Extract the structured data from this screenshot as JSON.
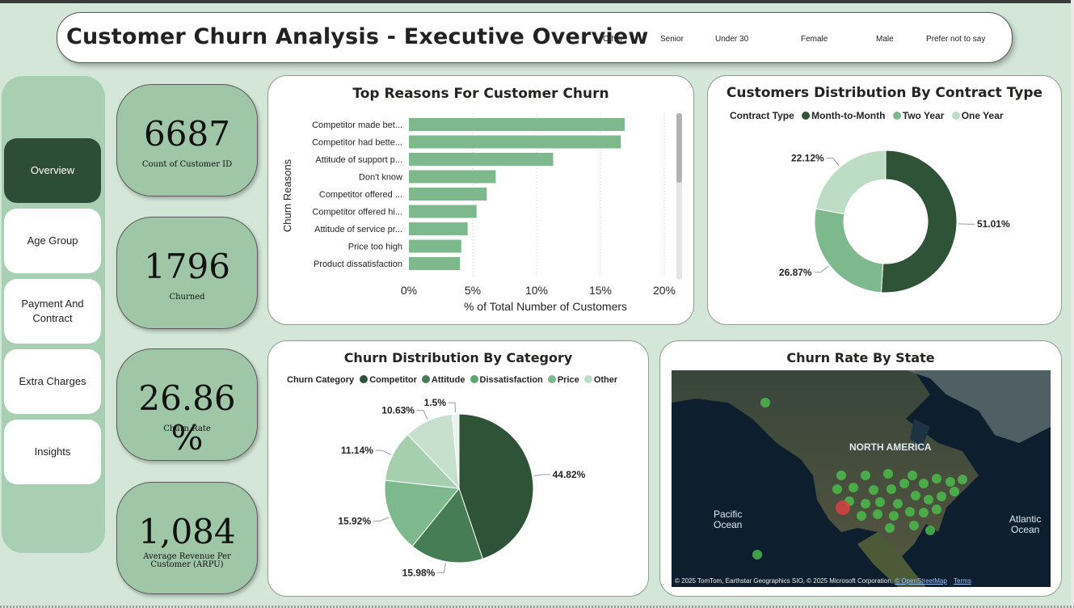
{
  "header": {
    "title": "Customer Churn Analysis - Executive Overview",
    "filters": [
      "Other",
      "Senior",
      "Under 30",
      "Female",
      "Male",
      "Prefer not to say"
    ]
  },
  "nav": {
    "items": [
      {
        "label": "Overview",
        "active": true
      },
      {
        "label": "Age Group",
        "active": false
      },
      {
        "label": "Payment And Contract",
        "active": false
      },
      {
        "label": "Extra Charges",
        "active": false
      },
      {
        "label": "Insights",
        "active": false
      }
    ]
  },
  "kpis": [
    {
      "value": "6687",
      "label": "Count of Customer ID"
    },
    {
      "value": "1796",
      "label": "Churned"
    },
    {
      "value": "26.86 %",
      "label": "Churn Rate"
    },
    {
      "value": "1,084",
      "label": "Average Revenue Per Customer (ARPU)"
    }
  ],
  "colors": {
    "dark_green": "#2f5337",
    "mid_green": "#467d54",
    "green": "#5fa56d",
    "light_green": "#7db98c",
    "pale_green": "#bcdcc4",
    "bar": "#7db98c",
    "accent_bg": "#d3e6d8"
  },
  "reasons_chart": {
    "title": "Top Reasons For Customer Churn",
    "ylabel": "Churn Reasons",
    "xlabel": "% of Total Number of Customers"
  },
  "contract_chart": {
    "title": "Customers Distribution By Contract Type",
    "legend_title": "Contract Type"
  },
  "category_chart": {
    "title": "Churn Distribution By Category",
    "legend_title": "Churn Category"
  },
  "map": {
    "title": "Churn Rate By State",
    "labels": {
      "continent": "NORTH AMERICA",
      "pacific": "Pacific\nOcean",
      "atlantic": "Atlantic\nOcean"
    },
    "attribution": "© 2025 TomTom, Earthstar Geographics SIO, © 2025 Microsoft Corporation, ",
    "osm_link": "© OpenStreetMap",
    "terms_link": "Terms"
  },
  "chart_data": [
    {
      "type": "bar",
      "orientation": "horizontal",
      "title": "Top Reasons For Customer Churn",
      "ylabel": "Churn Reasons",
      "xlabel": "% of Total Number of Customers",
      "categories": [
        "Competitor made bet...",
        "Competitor had bette...",
        "Attitude of support p...",
        "Don't know",
        "Competitor offered ...",
        "Competitor offered hi...",
        "Attitude of service pr...",
        "Price too high",
        "Product dissatisfaction"
      ],
      "values": [
        16.9,
        16.6,
        11.3,
        6.8,
        6.1,
        5.3,
        4.6,
        4.1,
        4.0
      ],
      "xticks": [
        "0%",
        "5%",
        "10%",
        "15%",
        "20%"
      ],
      "xlim": [
        0,
        20
      ],
      "grid": true
    },
    {
      "type": "pie",
      "variant": "donut",
      "title": "Customers Distribution By Contract Type",
      "legend_title": "Contract Type",
      "labels": [
        "Month-to-Month",
        "Two Year",
        "One Year"
      ],
      "values": [
        51.01,
        26.87,
        22.12
      ],
      "value_labels": [
        "51.01%",
        "26.87%",
        "22.12%"
      ],
      "colors": [
        "#2f5337",
        "#7db98c",
        "#bcdcc4"
      ],
      "legend_position": "top"
    },
    {
      "type": "pie",
      "title": "Churn Distribution By Category",
      "legend_title": "Churn Category",
      "labels": [
        "Competitor",
        "Attitude",
        "Dissatisfaction",
        "Price",
        "Other"
      ],
      "values": [
        44.82,
        15.98,
        15.92,
        11.14,
        10.63,
        1.5
      ],
      "value_labels": [
        "44.82%",
        "15.98%",
        "15.92%",
        "11.14%",
        "10.63%",
        "1.5%"
      ],
      "colors": [
        "#2f5337",
        "#467d54",
        "#7db98c",
        "#a6cfb0",
        "#c6e0cd",
        "#e9f3ec"
      ],
      "legend_position": "top"
    }
  ]
}
